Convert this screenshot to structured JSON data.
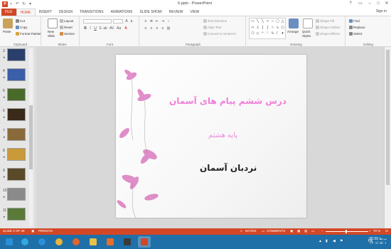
{
  "window": {
    "title": "6.pptx - PowerPoint",
    "app_icon": "P",
    "signin": "Sign in"
  },
  "quick_access": [
    "save-icon",
    "undo-icon",
    "redo-icon",
    "customize-icon"
  ],
  "tabs": [
    {
      "label": "FILE"
    },
    {
      "label": "HOME"
    },
    {
      "label": "INSERT"
    },
    {
      "label": "DESIGN"
    },
    {
      "label": "TRANSITIONS"
    },
    {
      "label": "ANIMATIONS"
    },
    {
      "label": "SLIDE SHOW"
    },
    {
      "label": "REVIEW"
    },
    {
      "label": "VIEW"
    }
  ],
  "ribbon": {
    "clipboard": {
      "paste": "Paste",
      "cut": "Cut",
      "copy": "Copy",
      "format_painter": "Format Painter",
      "label": "Clipboard"
    },
    "slides": {
      "new_slide": "New",
      "new_slide2": "Slide",
      "layout": "Layout",
      "reset": "Reset",
      "section": "Section",
      "label": "Slides"
    },
    "font": {
      "label": "Font"
    },
    "paragraph": {
      "text_direction": "Text Direction",
      "align_text": "Align Text",
      "convert_smartart": "Convert to SmartArt",
      "label": "Paragraph"
    },
    "drawing": {
      "arrange": "Arrange",
      "quick_styles": "Quick",
      "quick_styles2": "Styles",
      "shape_fill": "Shape Fill",
      "shape_outline": "Shape Outline",
      "shape_effects": "Shape Effects",
      "label": "Drawing"
    },
    "editing": {
      "find": "Find",
      "replace": "Replace",
      "select": "Select",
      "label": "Editing"
    }
  },
  "thumbnails": [
    {
      "num": "3",
      "color": "#2a3f6b"
    },
    {
      "num": "4",
      "color": "#3b5fa8"
    },
    {
      "num": "5",
      "color": "#4a6a2a"
    },
    {
      "num": "6",
      "color": "#3a2a1a"
    },
    {
      "num": "7",
      "color": "#8a6a3a"
    },
    {
      "num": "8",
      "color": "#c89a3a"
    },
    {
      "num": "9",
      "color": "#5a4a2a"
    },
    {
      "num": "10",
      "color": "#8a8a8a"
    },
    {
      "num": "11",
      "color": "#5a7a3a"
    }
  ],
  "slide": {
    "title": "درس ششم پیام های آسمان",
    "subtitle": "پایه هشتم",
    "body": "نردبان آسمان"
  },
  "status": {
    "slide_of": "SLIDE 2 OF 28",
    "language": "PERSIAN",
    "notes": "NOTES",
    "comments": "COMMENTS",
    "zoom": "70 %"
  },
  "taskbar": {
    "lang": "FA",
    "time": "05:39 ب.ظ",
    "date": "۱۴۰۱/۰۸/۰۱"
  }
}
